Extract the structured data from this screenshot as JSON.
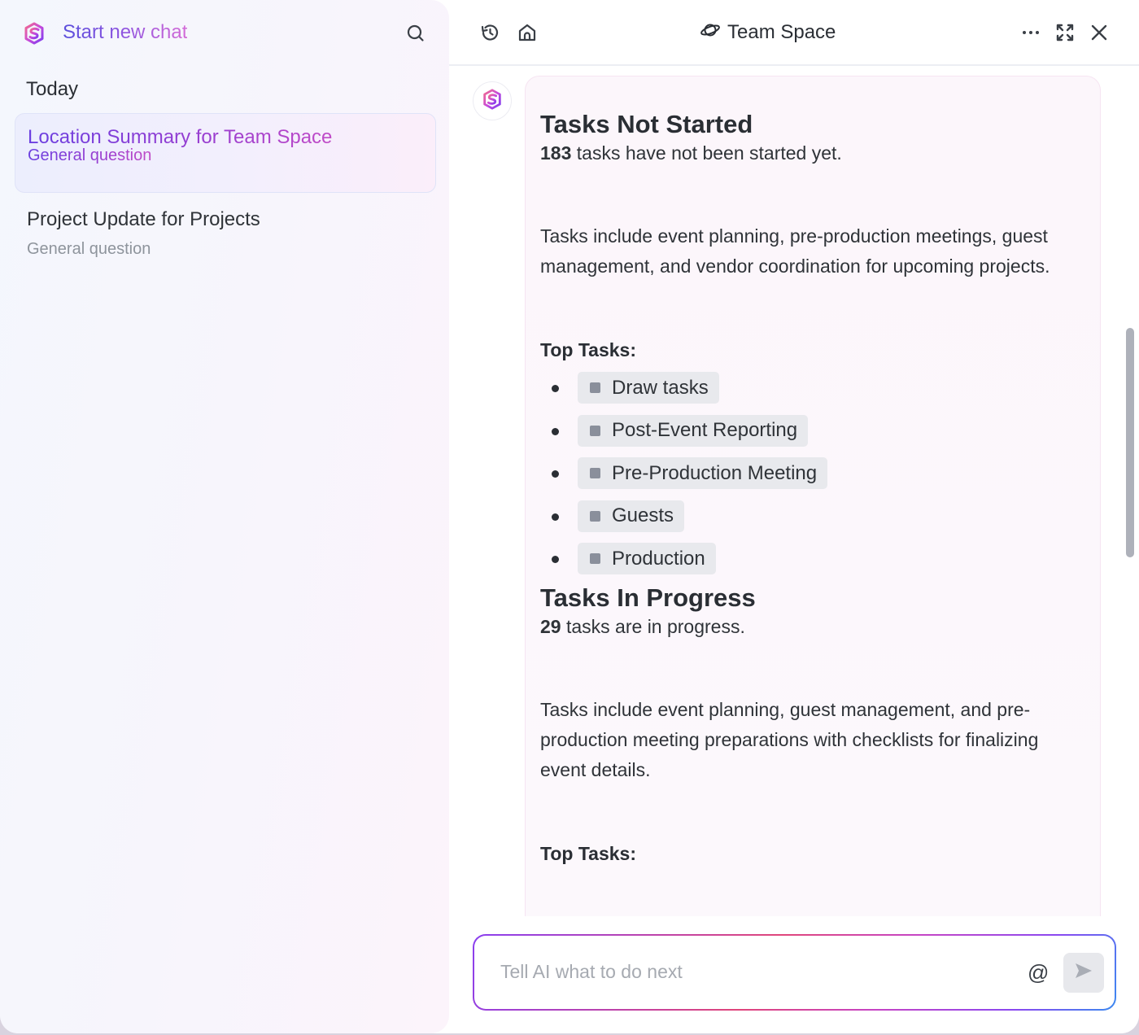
{
  "sidebar": {
    "new_chat_label": "Start new chat",
    "section_label": "Today",
    "items": [
      {
        "title": "Location Summary for Team Space",
        "subtitle": "General question",
        "active": true
      },
      {
        "title": "Project Update for Projects",
        "subtitle": "General question",
        "active": false
      }
    ]
  },
  "header": {
    "title": "Team Space"
  },
  "message": {
    "sections": [
      {
        "heading": "Tasks Not Started",
        "count": "183",
        "count_text": " tasks have not been started yet.",
        "description": "Tasks include event planning, pre-production meetings, guest management, and vendor coordination for upcoming projects.",
        "top_label": "Top Tasks:",
        "tasks": [
          "Draw tasks",
          "Post-Event Reporting",
          "Pre-Production Meeting",
          "Guests",
          "Production"
        ]
      },
      {
        "heading": "Tasks In Progress",
        "count": "29",
        "count_text": " tasks are in progress.",
        "description": "Tasks include event planning, guest management, and pre-production meeting preparations with checklists for finalizing event details.",
        "top_label": "Top Tasks:"
      }
    ]
  },
  "composer": {
    "placeholder": "Tell AI what to do next",
    "value": "",
    "mention_symbol": "@"
  },
  "colors": {
    "accent_start": "#5b4fdc",
    "accent_end": "#d46bd7",
    "chip_bg": "#e8e9ed",
    "chip_square": "#8a8f9b"
  }
}
